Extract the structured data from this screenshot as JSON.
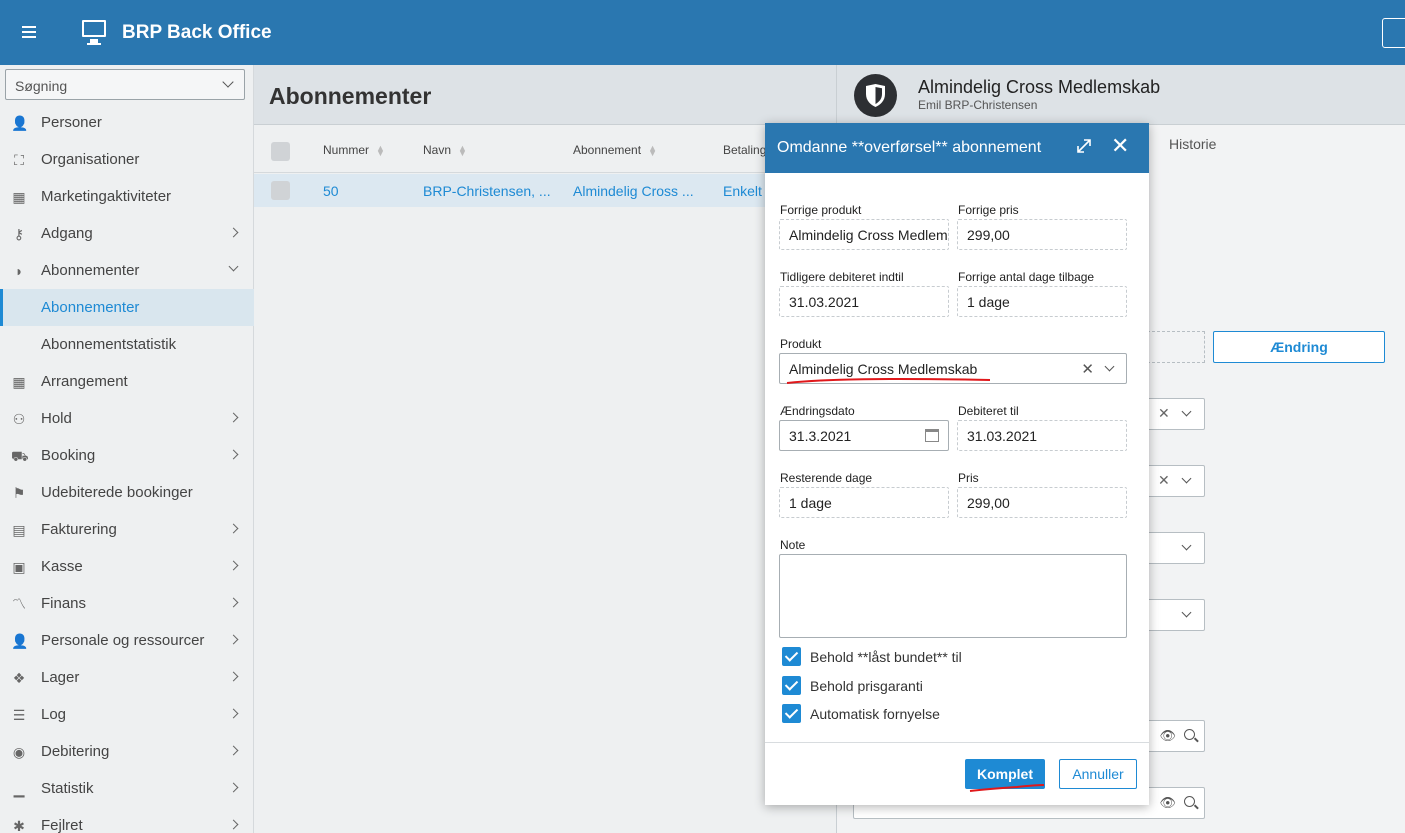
{
  "app": {
    "title": "BRP Back Office"
  },
  "sidebar": {
    "search_label": "Søgning",
    "items": [
      {
        "label": "Personer",
        "icon": "person-icon",
        "arrow": "none"
      },
      {
        "label": "Organisationer",
        "icon": "org-tree-icon",
        "arrow": "none"
      },
      {
        "label": "Marketingaktiviteter",
        "icon": "calendar-icon",
        "arrow": "none"
      },
      {
        "label": "Adgang",
        "icon": "key-icon",
        "arrow": "right"
      },
      {
        "label": "Abonnementer",
        "icon": "shield-icon",
        "arrow": "down"
      },
      {
        "label": "Abonnementer",
        "icon": "",
        "arrow": "none",
        "active": true
      },
      {
        "label": "Abonnementstatistik",
        "icon": "",
        "arrow": "none"
      },
      {
        "label": "Arrangement",
        "icon": "calendar-clock-icon",
        "arrow": "none"
      },
      {
        "label": "Hold",
        "icon": "group-icon",
        "arrow": "right"
      },
      {
        "label": "Booking",
        "icon": "cart-icon",
        "arrow": "right"
      },
      {
        "label": "Udebiterede bookinger",
        "icon": "flag-icon",
        "arrow": "none"
      },
      {
        "label": "Fakturering",
        "icon": "invoice-icon",
        "arrow": "right"
      },
      {
        "label": "Kasse",
        "icon": "cash-register-icon",
        "arrow": "right"
      },
      {
        "label": "Finans",
        "icon": "trend-icon",
        "arrow": "right"
      },
      {
        "label": "Personale og ressourcer",
        "icon": "staff-icon",
        "arrow": "right"
      },
      {
        "label": "Lager",
        "icon": "boxes-icon",
        "arrow": "right"
      },
      {
        "label": "Log",
        "icon": "list-icon",
        "arrow": "right"
      },
      {
        "label": "Debitering",
        "icon": "coins-icon",
        "arrow": "right"
      },
      {
        "label": "Statistik",
        "icon": "bar-chart-icon",
        "arrow": "right"
      },
      {
        "label": "Fejlret",
        "icon": "bug-icon",
        "arrow": "right"
      }
    ]
  },
  "list": {
    "title": "Abonnementer",
    "columns": [
      "Nummer",
      "Navn",
      "Abonnement",
      "Betaling"
    ],
    "rows": [
      {
        "nummer": "50",
        "navn": "BRP-Christensen, ...",
        "abonnement": "Almindelig Cross ...",
        "betaling": "Enkelt"
      }
    ]
  },
  "detail": {
    "title": "Almindelig Cross Medlemskab",
    "subtitle": "Emil BRP-Christensen",
    "tab_history": "Historie",
    "change_button": "Ændring"
  },
  "dialog": {
    "title": "Omdanne **overførsel** abonnement",
    "fields": {
      "prev_product_label": "Forrige produkt",
      "prev_product_value": "Almindelig Cross Medlemskab",
      "prev_price_label": "Forrige pris",
      "prev_price_value": "299,00",
      "prev_billed_label": "Tidligere debiteret indtil",
      "prev_billed_value": "31.03.2021",
      "prev_days_label": "Forrige antal dage tilbage",
      "prev_days_value": "1 dage",
      "product_label": "Produkt",
      "product_value": "Almindelig Cross Medlemskab",
      "change_date_label": "Ændringsdato",
      "change_date_value": "31.3.2021",
      "billed_to_label": "Debiteret til",
      "billed_to_value": "31.03.2021",
      "remaining_label": "Resterende dage",
      "remaining_value": "1 dage",
      "price_label": "Pris",
      "price_value": "299,00",
      "note_label": "Note"
    },
    "checkboxes": [
      {
        "label": "Behold **låst bundet** til",
        "checked": true
      },
      {
        "label": "Behold prisgaranti",
        "checked": true
      },
      {
        "label": "Automatisk fornyelse",
        "checked": true
      }
    ],
    "ok_label": "Komplet",
    "cancel_label": "Annuller"
  },
  "colors": {
    "brand": "#2a77b0",
    "accent": "#1e8ad4",
    "annotation": "#e0181b"
  }
}
